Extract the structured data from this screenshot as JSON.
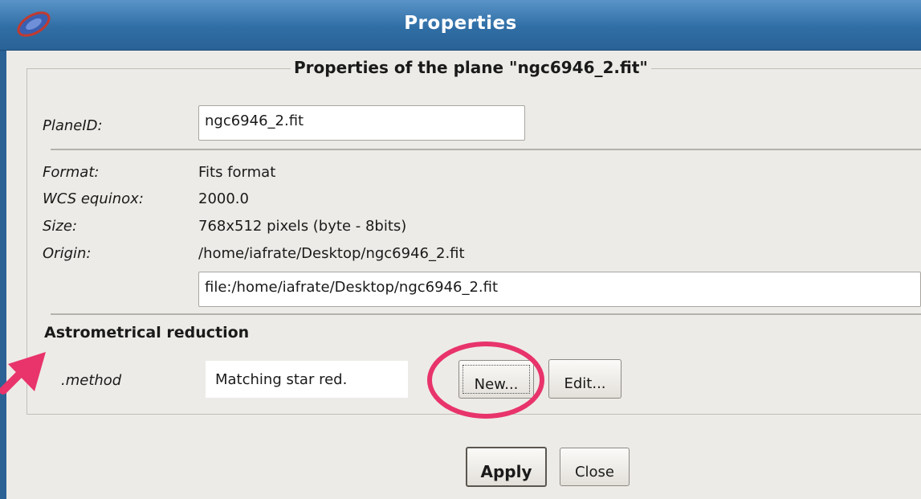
{
  "window": {
    "title": "Properties",
    "app_icon": "aladin-ellipse-icon"
  },
  "group": {
    "title": "Properties of the plane \"ngc6946_2.fit\""
  },
  "fields": {
    "plane_id_label": "PlaneID:",
    "plane_id_value": "ngc6946_2.fit",
    "format_label": "Format:",
    "format_value": "Fits format",
    "wcs_label": "WCS equinox:",
    "wcs_value": "2000.0",
    "size_label": "Size:",
    "size_value": "768x512 pixels (byte - 8bits)",
    "origin_label": "Origin:",
    "origin_value": "/home/iafrate/Desktop/ngc6946_2.fit",
    "url_value": "file:/home/iafrate/Desktop/ngc6946_2.fit"
  },
  "astrometry": {
    "section_title": "Astrometrical reduction",
    "method_label": ".method",
    "method_value": "Matching star red.",
    "new_label": "New...",
    "edit_label": "Edit..."
  },
  "buttons": {
    "apply_label": "Apply",
    "close_label": "Close"
  },
  "annotation": {
    "color": "#e8336b",
    "shapes": [
      "highlight-circle",
      "pointer-arrow"
    ]
  }
}
